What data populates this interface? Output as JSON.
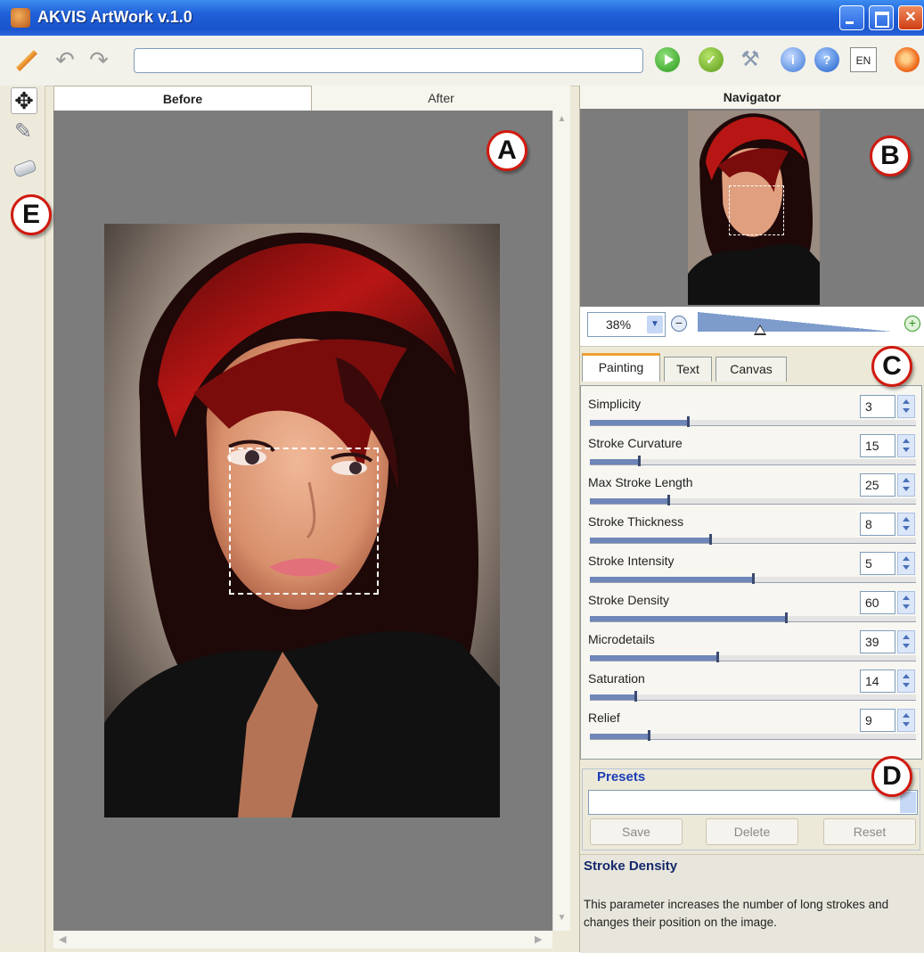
{
  "window": {
    "title": "AKVIS ArtWork v.1.0"
  },
  "toolbar": {
    "language": "EN"
  },
  "view_tabs": {
    "before": "Before",
    "after": "After"
  },
  "markers": {
    "a": "A",
    "b": "B",
    "c": "C",
    "d": "D",
    "e": "E"
  },
  "navigator": {
    "title": "Navigator",
    "zoom": "38%",
    "zoom_slider_level_pct": 32
  },
  "param_tabs": {
    "painting": "Painting",
    "text": "Text",
    "canvas": "Canvas"
  },
  "parameters": [
    {
      "label": "Simplicity",
      "value": "3",
      "level": 0.3
    },
    {
      "label": "Stroke Curvature",
      "value": "15",
      "level": 0.15
    },
    {
      "label": "Max Stroke Length",
      "value": "25",
      "level": 0.24
    },
    {
      "label": "Stroke Thickness",
      "value": "8",
      "level": 0.37
    },
    {
      "label": "Stroke Intensity",
      "value": "5",
      "level": 0.5
    },
    {
      "label": "Stroke Density",
      "value": "60",
      "level": 0.6
    },
    {
      "label": "Microdetails",
      "value": "39",
      "level": 0.39
    },
    {
      "label": "Saturation",
      "value": "14",
      "level": 0.14
    },
    {
      "label": "Relief",
      "value": "9",
      "level": 0.18
    }
  ],
  "presets": {
    "title": "Presets",
    "selected": "",
    "save": "Save",
    "delete": "Delete",
    "reset": "Reset"
  },
  "hint": {
    "title": "Stroke Density",
    "body": "This parameter increases the number of long strokes and changes their position on the image."
  },
  "colors": {
    "titlebar": "#1f5fd8",
    "marker_ring": "#d01a10",
    "presets_title": "#1a3cb8",
    "slider_fill": "#6f86b8"
  }
}
